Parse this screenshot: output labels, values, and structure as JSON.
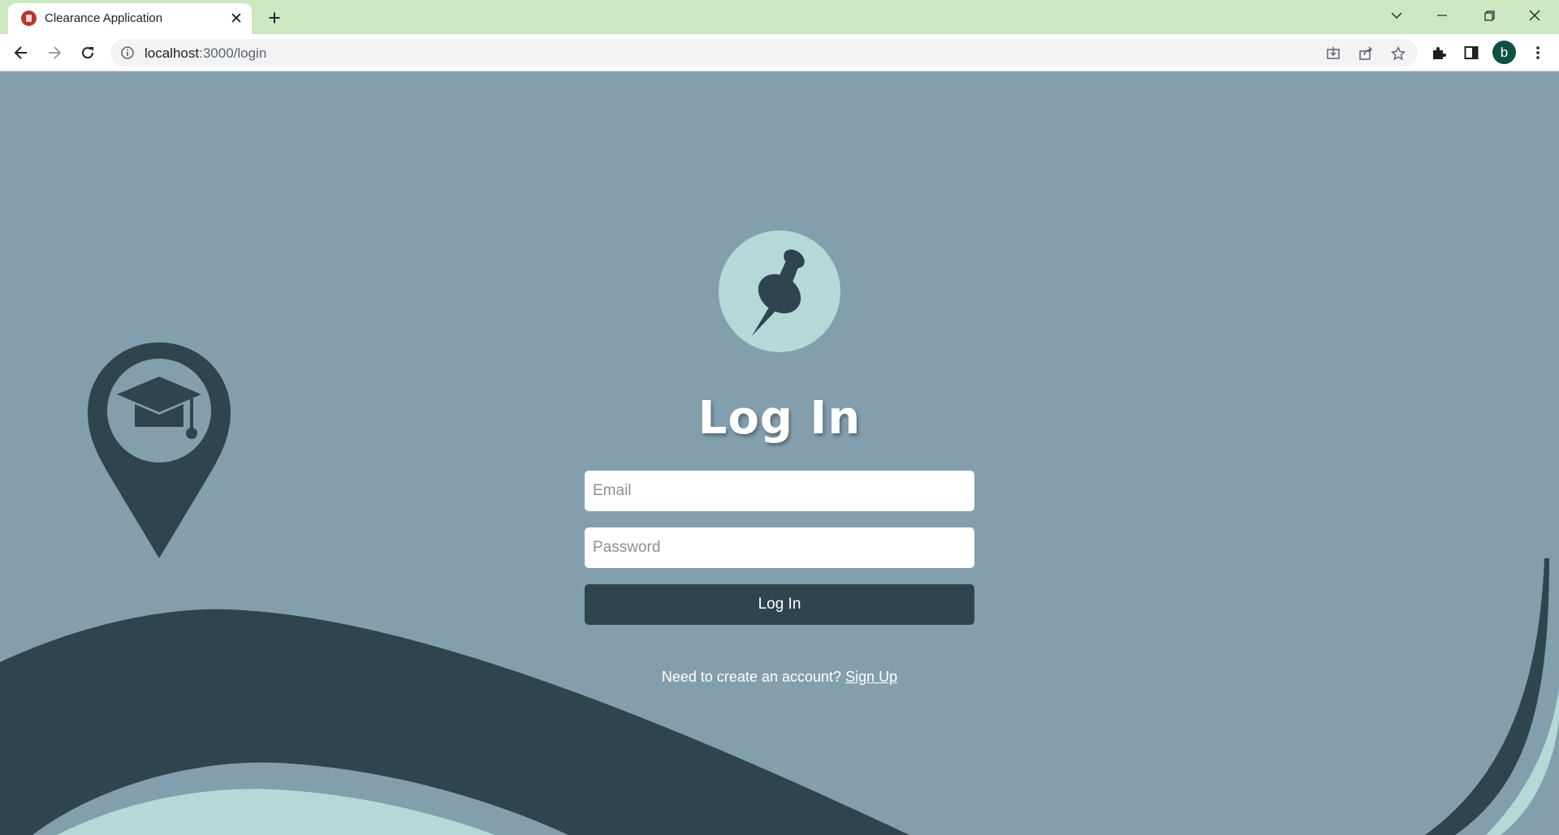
{
  "browser": {
    "tab_title": "Clearance Application",
    "url_host": "localhost",
    "url_path": ":3000/login",
    "profile_initial": "b",
    "icons": {
      "favicon": "red-circle-favicon",
      "close": "close-icon",
      "new_tab": "plus-icon",
      "back": "arrow-left-icon",
      "forward": "arrow-right-icon",
      "reload": "reload-icon",
      "info": "info-icon",
      "install": "install-icon",
      "share": "share-icon",
      "bookmark": "star-icon",
      "extensions": "puzzle-icon",
      "side_panel": "side-panel-icon",
      "menu": "kebab-menu-icon"
    }
  },
  "login": {
    "heading": "Log In",
    "email_placeholder": "Email",
    "password_placeholder": "Password",
    "submit_label": "Log In",
    "signup_prompt": "Need to create an account?",
    "signup_link": "Sign Up",
    "logo_icon": "pushpin-icon",
    "side_icon": "graduation-location-pin-icon"
  },
  "colors": {
    "page_background": "#839fad",
    "dark_accent": "#2e444f",
    "light_accent": "#b6d9d8",
    "tabstrip": "#cbe8c1"
  }
}
